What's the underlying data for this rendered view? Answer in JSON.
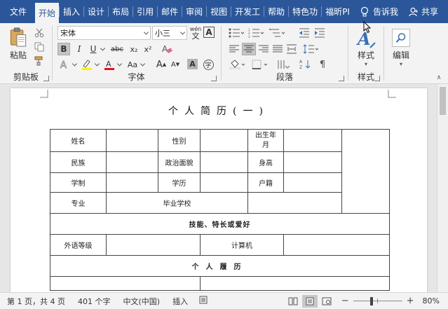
{
  "tabs": [
    {
      "label": "文件",
      "active": false
    },
    {
      "label": "开始",
      "active": true
    },
    {
      "label": "插入",
      "active": false
    },
    {
      "label": "设计",
      "active": false
    },
    {
      "label": "布局",
      "active": false
    },
    {
      "label": "引用",
      "active": false
    },
    {
      "label": "邮件",
      "active": false
    },
    {
      "label": "审阅",
      "active": false
    },
    {
      "label": "视图",
      "active": false
    },
    {
      "label": "开发工",
      "active": false
    },
    {
      "label": "帮助",
      "active": false
    },
    {
      "label": "特色功",
      "active": false
    },
    {
      "label": "福昕PI",
      "active": false
    }
  ],
  "tell_me": "告诉我",
  "share": "共享",
  "clipboard": {
    "paste": "粘贴",
    "label": "剪贴板"
  },
  "font": {
    "name": "宋体",
    "size": "小三",
    "label": "字体",
    "bold": "B",
    "italic": "I",
    "underline": "U",
    "strike": "abc",
    "subscript": "x₂",
    "superscript": "x²",
    "change_case": "Aa",
    "grow": "A",
    "shrink": "A",
    "char_shade": "A",
    "phonetic": "wén",
    "enclose": "字",
    "font_color": "#e81123",
    "highlight_color": "#fff200"
  },
  "paragraph": {
    "label": "段落"
  },
  "styles": {
    "button": "样式",
    "label": "样式"
  },
  "editing": {
    "button": "编辑"
  },
  "document": {
    "title": "个人简历(一)",
    "rows": {
      "name": "姓名",
      "gender": "性别",
      "birth": "出生年月",
      "ethnic": "民族",
      "politics": "政治面貌",
      "height": "身高",
      "schooling": "学制",
      "education": "学历",
      "hukou": "户籍",
      "major": "专业",
      "school": "毕业学校",
      "skills": "技能、特长或爱好",
      "language": "外语等级",
      "computer": "计算机",
      "resume": "个人履历"
    }
  },
  "status": {
    "page": "第 1 页，共 4 页",
    "words": "401 个字",
    "language": "中文(中国)",
    "mode": "插入",
    "zoom": "80%",
    "zoom_level": 0.8
  }
}
